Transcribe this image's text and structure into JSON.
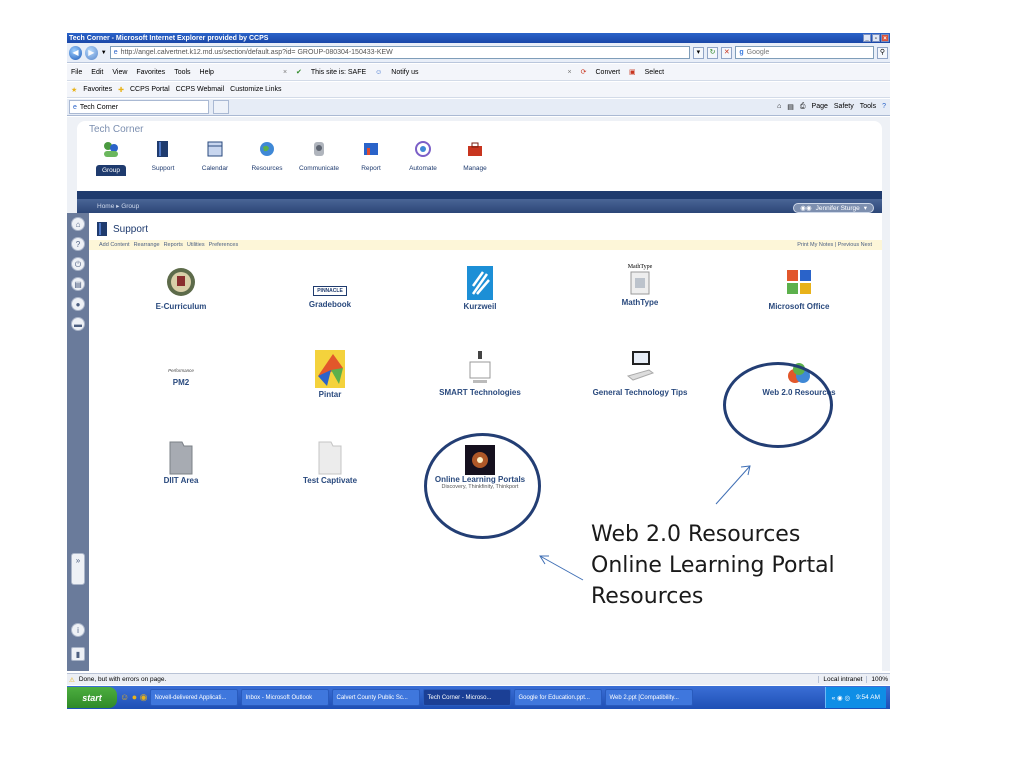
{
  "browser": {
    "title": "Tech Corner - Microsoft Internet Explorer provided by CCPS",
    "address": "http://angel.calvertnet.k12.md.us/section/default.asp?id= GROUP-080304-150433-KEW",
    "search_placeholder": "Google",
    "menu": [
      "File",
      "Edit",
      "View",
      "Favorites",
      "Tools",
      "Help"
    ],
    "safety": "This site is: SAFE",
    "notify": "Notify us",
    "convert": "Convert",
    "select": "Select",
    "favorites_label": "Favorites",
    "favorites": [
      "CCPS Portal",
      "CCPS Webmail",
      "Customize Links"
    ],
    "tab": "Tech Corner",
    "tools": [
      "Page",
      "Safety",
      "Tools"
    ]
  },
  "app": {
    "title": "Tech Corner",
    "nav": [
      "Group",
      "Support",
      "Calendar",
      "Resources",
      "Communicate",
      "Report",
      "Automate",
      "Manage"
    ],
    "breadcrumb": "Home ▸ Group",
    "user": "Jennifer Sturge",
    "page_title": "Support",
    "subnav": [
      "Add Content",
      "Rearrange",
      "Reports",
      "Utilities",
      "Preferences"
    ],
    "subnav_right": "Print  My Notes  |  Previous  Next"
  },
  "tiles": [
    {
      "label": "E-Curriculum",
      "icon": "seal-icon"
    },
    {
      "label": "Gradebook",
      "logo": "PINNACLE",
      "icon": "pinnacle-logo"
    },
    {
      "label": "Kurzweil",
      "icon": "kurzweil-icon"
    },
    {
      "label": "MathType",
      "logo": "MathType",
      "icon": "mathtype-icon"
    },
    {
      "label": "Microsoft Office",
      "icon": "office-icon"
    },
    {
      "label": "PM2",
      "logo": "Performance",
      "icon": "performance-logo"
    },
    {
      "label": "Pintar",
      "icon": "pintar-icon"
    },
    {
      "label": "SMART Technologies",
      "icon": "projector-icon"
    },
    {
      "label": "General Technology Tips",
      "icon": "computer-icon"
    },
    {
      "label": "Web 2.0 Resources",
      "icon": "web20-icon"
    },
    {
      "label": "DIIT Area",
      "icon": "folder-icon"
    },
    {
      "label": "Test Captivate",
      "icon": "folder-icon"
    },
    {
      "label": "Online Learning Portals",
      "sub": "Discovery, Thinkfinity, Thinkport",
      "icon": "galaxy-icon"
    }
  ],
  "status": {
    "text": "Done, but with errors on page.",
    "zone": "Local intranet",
    "zoom": "100%"
  },
  "taskbar": {
    "start": "start",
    "items": [
      "Novell-delivered Applicati...",
      "Inbox - Microsoft Outlook",
      "Calvert County Public Sc...",
      "Tech Corner - Microso...",
      "Google for Education.ppt...",
      "Web 2.ppt [Compatibility..."
    ],
    "clock": "9:54 AM"
  },
  "annotation": [
    "Web 2.0 Resources",
    "Online Learning Portal",
    "Resources"
  ]
}
